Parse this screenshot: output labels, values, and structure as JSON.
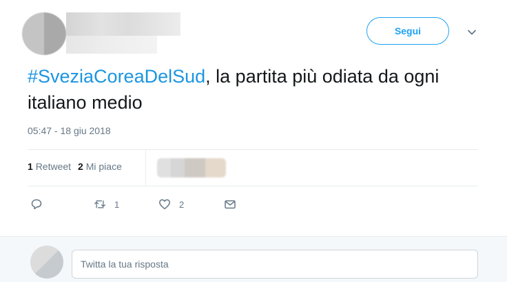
{
  "header": {
    "follow_label": "Segui",
    "caret_icon": "chevron-down-icon"
  },
  "tweet": {
    "hashtag": "#SveziaCoreaDelSud",
    "text_rest": ", la partita più odiata da ogni italiano medio",
    "timestamp": "05:47 - 18 giu 2018",
    "retweets_count": "1",
    "retweets_label": "Retweet",
    "likes_count": "2",
    "likes_label": "Mi piace"
  },
  "actions": {
    "reply_icon": "reply-icon",
    "retweet_icon": "retweet-icon",
    "retweet_count": "1",
    "like_icon": "heart-icon",
    "like_count": "2",
    "dm_icon": "envelope-icon"
  },
  "reply": {
    "placeholder": "Twitta la tua risposta"
  },
  "colors": {
    "accent": "#1da1f2",
    "hashtag": "#1b95e0",
    "muted": "#657786",
    "text": "#14171a"
  }
}
